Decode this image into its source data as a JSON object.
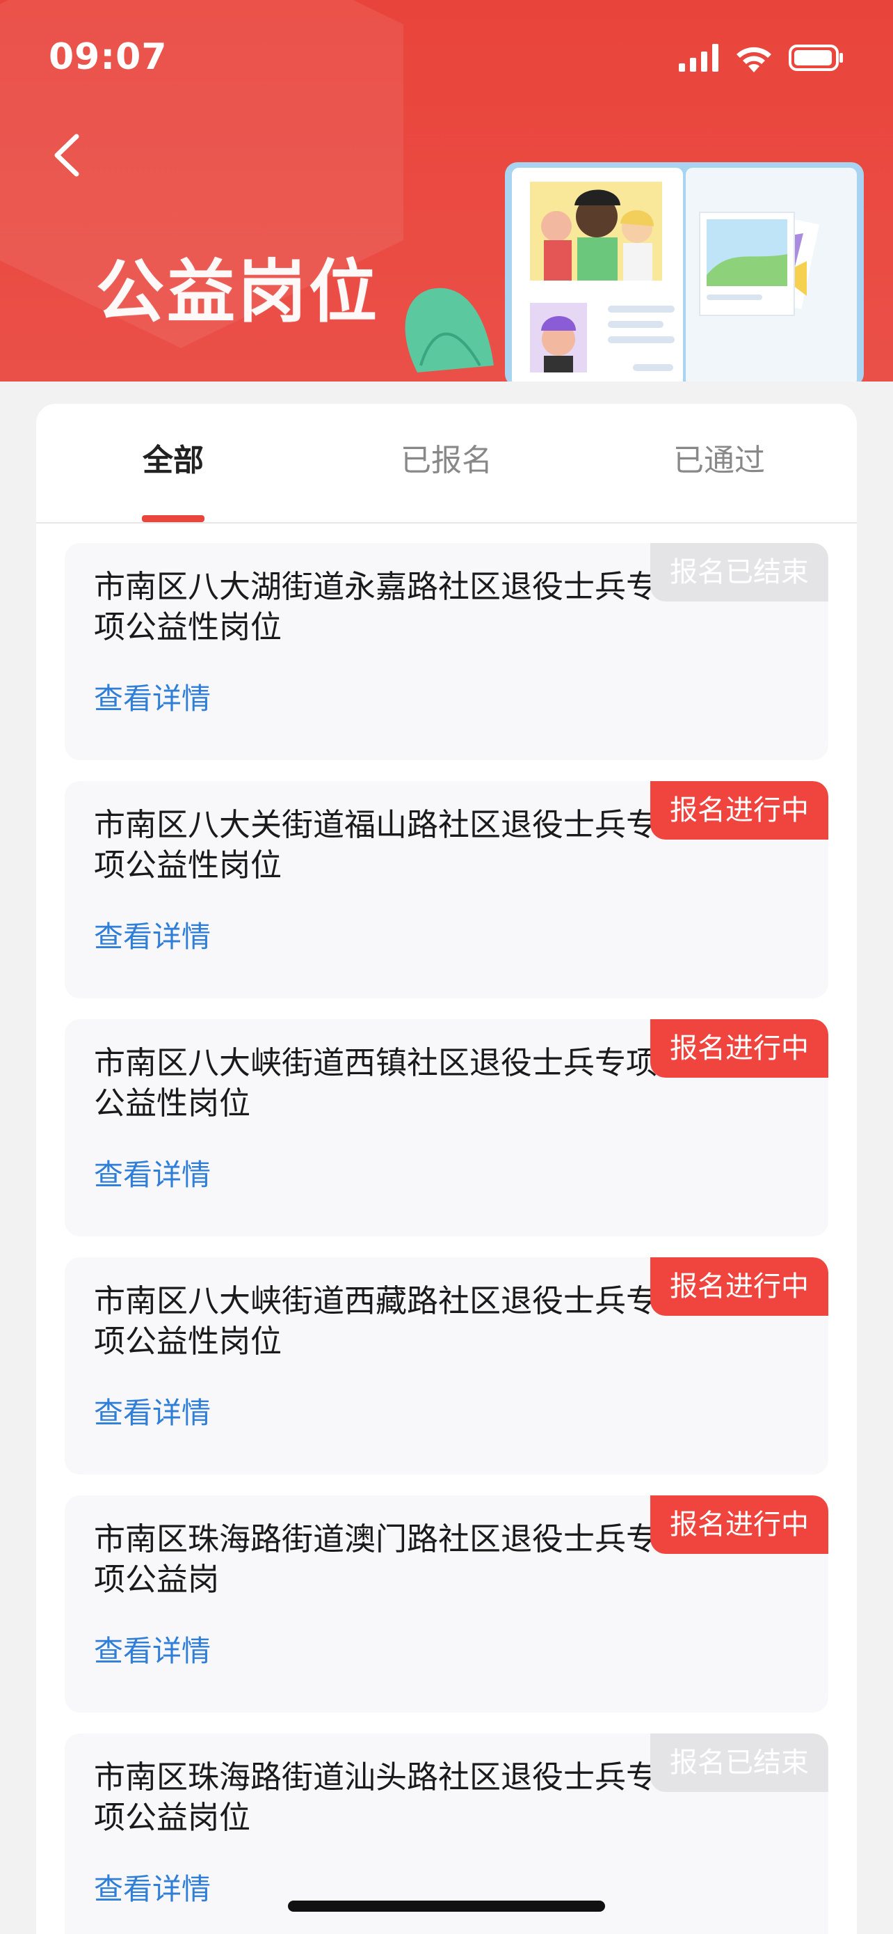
{
  "status_bar": {
    "time": "09:07"
  },
  "header": {
    "title": "公益岗位"
  },
  "tabs": [
    {
      "label": "全部"
    },
    {
      "label": "已报名"
    },
    {
      "label": "已通过"
    }
  ],
  "cards": [
    {
      "title": "市南区八大湖街道永嘉路社区退役士兵专项公益性岗位",
      "link": "查看详情",
      "status": "报名已结束"
    },
    {
      "title": "市南区八大关街道福山路社区退役士兵专项公益性岗位",
      "link": "查看详情",
      "status": "报名进行中"
    },
    {
      "title": "市南区八大峡街道西镇社区退役士兵专项公益性岗位",
      "link": "查看详情",
      "status": "报名进行中"
    },
    {
      "title": "市南区八大峡街道西藏路社区退役士兵专项公益性岗位",
      "link": "查看详情",
      "status": "报名进行中"
    },
    {
      "title": "市南区珠海路街道澳门路社区退役士兵专项公益岗",
      "link": "查看详情",
      "status": "报名进行中"
    },
    {
      "title": "市南区珠海路街道汕头路社区退役士兵专项公益岗位",
      "link": "查看详情",
      "status": "报名已结束"
    }
  ],
  "colors": {
    "accent": "#e9443b",
    "link": "#2f7ed8",
    "badge_open": "#f0453e",
    "badge_closed": "#e4e4e6"
  }
}
